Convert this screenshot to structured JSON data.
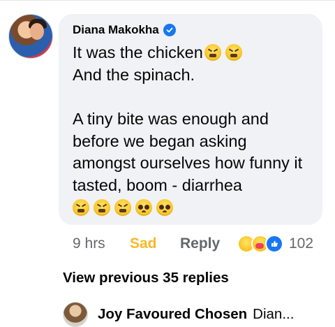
{
  "comment": {
    "author": "Diana Makokha",
    "verified": true,
    "lines": [
      "It was the chicken",
      "And the spinach.",
      "",
      "A tiny bite was enough and",
      "before we began asking",
      "amongst ourselves how funny it",
      "tasted, boom - diarrhea",
      ""
    ],
    "emojis_line1": [
      "tired-face-emoji",
      "tired-face-emoji"
    ],
    "emojis_last_line": [
      "tired-face-emoji",
      "tired-face-emoji",
      "tired-face-emoji",
      "pleading-face-emoji",
      "pleading-face-emoji"
    ],
    "time": "9 hrs",
    "reaction_label": "Sad",
    "reply_label": "Reply",
    "reaction_icons": [
      "sad-reaction-icon",
      "care-reaction-icon",
      "like-reaction-icon"
    ],
    "reaction_count": "102"
  },
  "view_previous": "View previous 35 replies",
  "reply_preview": {
    "name": "Joy Favoured Chosen",
    "snippet": "Dian..."
  },
  "colors": {
    "bubble_bg": "#f0f2f5",
    "sad_accent": "#f7b928",
    "like_blue": "#1877f2",
    "secondary_text": "#65676b"
  }
}
